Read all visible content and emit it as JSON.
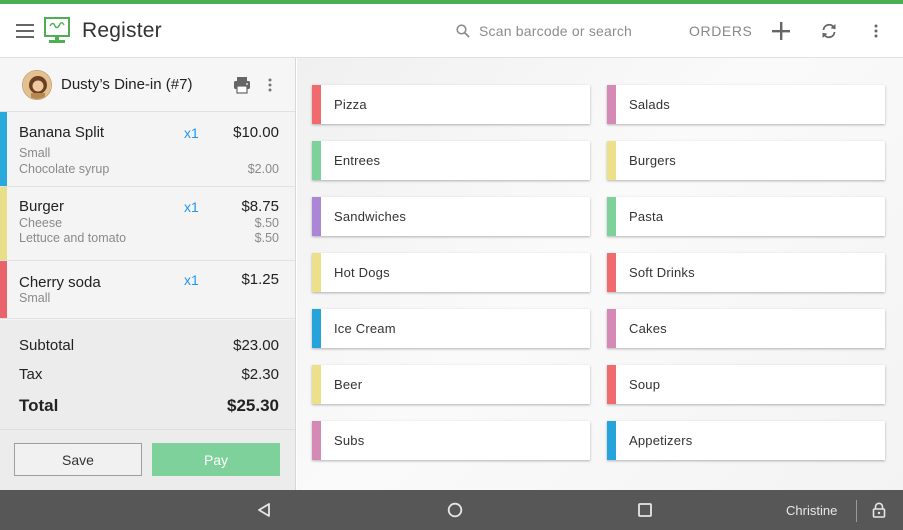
{
  "header": {
    "app_title": "Register",
    "menu_icon": "hamburger-menu-icon",
    "logo_icon": "register-monitor-logo",
    "search_placeholder": "Scan barcode or search",
    "orders_label": "ORDERS",
    "accent_color": "#4caf50"
  },
  "order": {
    "title": "Dusty’s Dine-in (#7)",
    "items": [
      {
        "name": "Banana Split",
        "qty": "x1",
        "price": "$10.00",
        "color": "#29a8dc",
        "modifiers": [
          {
            "name": "Small",
            "price": ""
          },
          {
            "name": "Chocolate syrup",
            "price": "$2.00"
          }
        ]
      },
      {
        "name": "Burger",
        "qty": "x1",
        "price": "$8.75",
        "color": "#e9df8a",
        "modifiers": [
          {
            "name": "Cheese",
            "price": "$.50"
          },
          {
            "name": "Lettuce and tomato",
            "price": "$.50"
          }
        ]
      },
      {
        "name": "Cherry soda",
        "qty": "x1",
        "price": "$1.25",
        "color": "#e9636a",
        "modifiers": [
          {
            "name": "Small",
            "price": ""
          }
        ]
      }
    ],
    "subtotal_label": "Subtotal",
    "subtotal": "$23.00",
    "tax_label": "Tax",
    "tax": "$2.30",
    "total_label": "Total",
    "total": "$25.30",
    "save_label": "Save",
    "pay_label": "Pay",
    "pay_color": "#7ed19b"
  },
  "categories": [
    {
      "label": "Pizza",
      "color": "#ef6b6e"
    },
    {
      "label": "Salads",
      "color": "#d48ab5"
    },
    {
      "label": "Entrees",
      "color": "#7ed19b"
    },
    {
      "label": "Burgers",
      "color": "#eedf8b"
    },
    {
      "label": "Sandwiches",
      "color": "#ac86d6"
    },
    {
      "label": "Pasta",
      "color": "#7ed19b"
    },
    {
      "label": "Hot Dogs",
      "color": "#eedf8b"
    },
    {
      "label": "Soft Drinks",
      "color": "#ef6b6e"
    },
    {
      "label": "Ice Cream",
      "color": "#25a4dc"
    },
    {
      "label": "Cakes",
      "color": "#d48ab5"
    },
    {
      "label": "Beer",
      "color": "#eedf8b"
    },
    {
      "label": "Soup",
      "color": "#ef6b6e"
    },
    {
      "label": "Subs",
      "color": "#d48ab5"
    },
    {
      "label": "Appetizers",
      "color": "#25a4dc"
    }
  ],
  "navbar": {
    "user_name": "Christine"
  }
}
